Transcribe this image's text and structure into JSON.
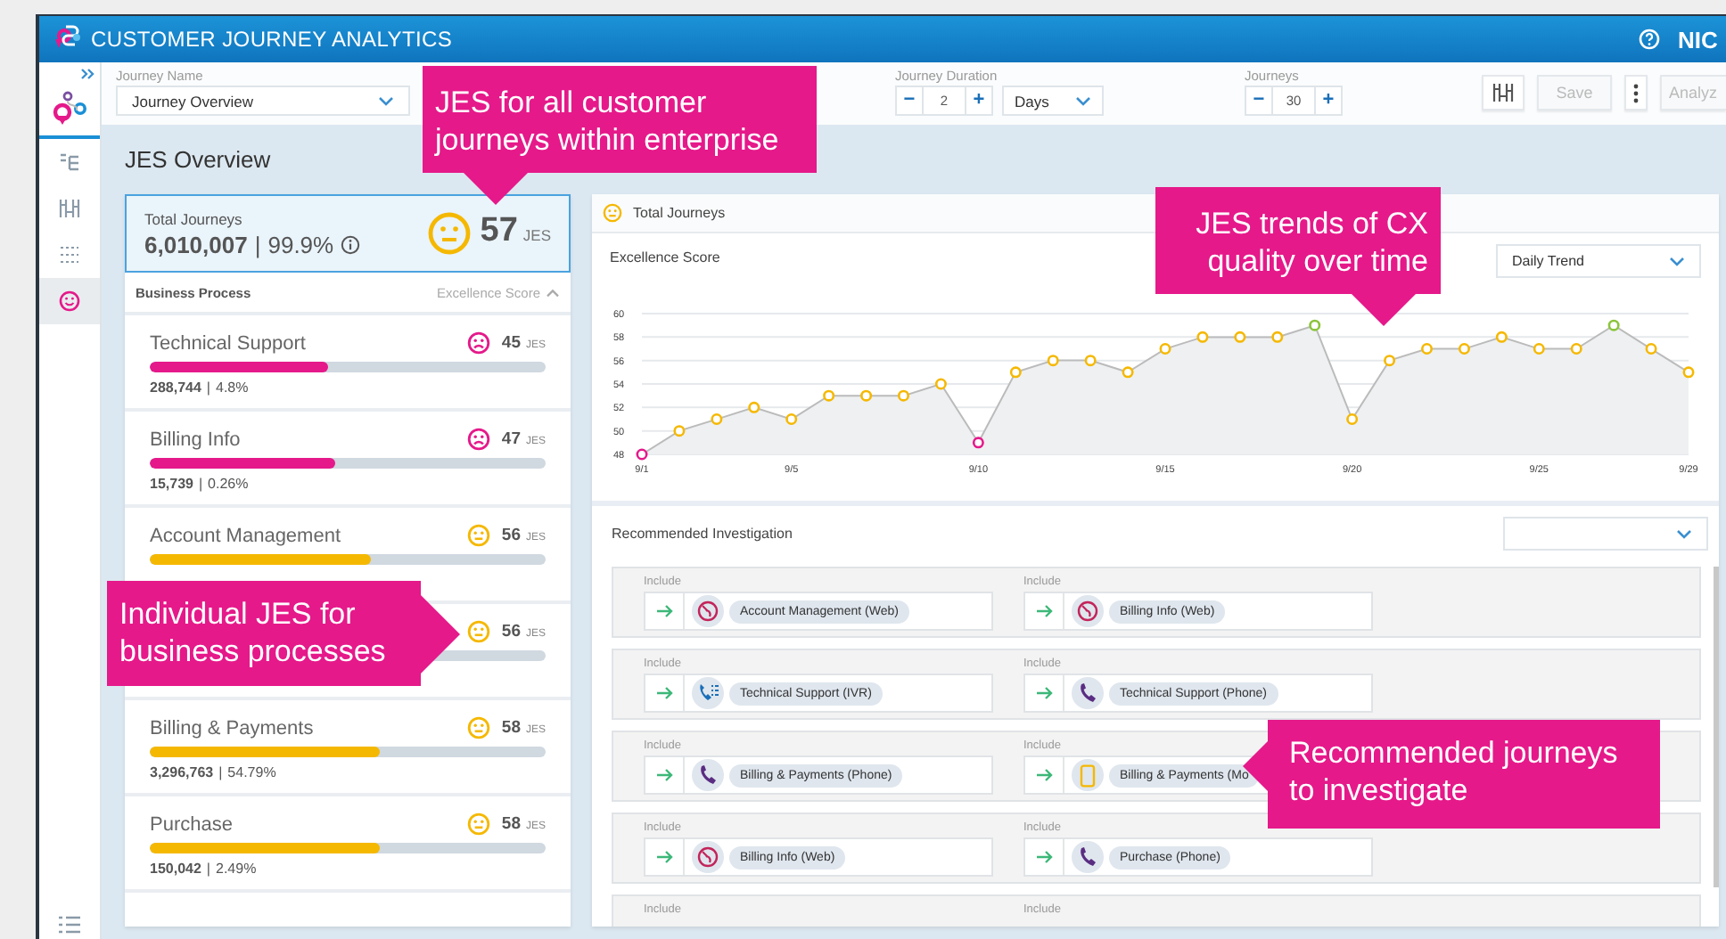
{
  "app": {
    "title": "CUSTOMER JOURNEY ANALYTICS",
    "brand": "NIC"
  },
  "sidebar": {
    "items": [
      {
        "kind": "flow",
        "selected": false
      },
      {
        "kind": "columns",
        "selected": false
      },
      {
        "kind": "grid",
        "selected": false
      },
      {
        "kind": "smiley",
        "selected": true
      }
    ]
  },
  "toolbar": {
    "journey_name": {
      "label": "Journey Name",
      "value": "Journey Overview"
    },
    "journey_duration": {
      "label": "Journey Duration",
      "minus": "−",
      "value": "2",
      "plus": "+",
      "unit": "Days"
    },
    "journeys": {
      "label": "Journeys",
      "minus": "−",
      "value": "30",
      "plus": "+"
    },
    "buttons": [
      {
        "kind": "icon"
      },
      {
        "kind": "text",
        "label": "Save",
        "disabled": true
      },
      {
        "kind": "kebab"
      },
      {
        "kind": "text",
        "label": "Analyz",
        "disabled": true
      }
    ]
  },
  "overview": {
    "title": "JES Overview",
    "total": {
      "label": "Total Journeys",
      "count": "6,010,007",
      "separator": "|",
      "percent": "99.9%",
      "score": "57",
      "unit": "JES"
    },
    "header": {
      "left": "Business Process",
      "right": "Excellence Score"
    },
    "processes": [
      {
        "name": "Technical Support",
        "kind": "sad",
        "color": "#e5198a",
        "score": "45",
        "unit": "JES",
        "level": 0.45,
        "count": "288,744",
        "separator": "|",
        "percent": "4.8%"
      },
      {
        "name": "Billing Info",
        "kind": "sad",
        "color": "#e5198a",
        "score": "47",
        "unit": "JES",
        "level": 0.47,
        "count": "15,739",
        "separator": "|",
        "percent": "0.26%"
      },
      {
        "name": "Account Management",
        "kind": "neutral",
        "color": "#f5b800",
        "score": "56",
        "unit": "JES",
        "level": 0.56
      },
      {
        "kind": "neutral",
        "color": "#f5b800",
        "score": "56",
        "unit": "JES"
      },
      {
        "name": "Billing & Payments",
        "kind": "neutral",
        "color": "#f5b800",
        "score": "58",
        "unit": "JES",
        "level": 0.58,
        "count": "3,296,763",
        "separator": "|",
        "percent": "54.79%"
      },
      {
        "name": "Purchase",
        "kind": "neutral",
        "color": "#f5b800",
        "score": "58",
        "unit": "JES",
        "level": 0.58,
        "count": "150,042",
        "separator": "|",
        "percent": "2.49%"
      }
    ]
  },
  "trend": {
    "title": "Total Journeys",
    "period": "Daily Trend",
    "chart_data": {
      "type": "line",
      "categories": [
        "9/1",
        null,
        null,
        null,
        "9/5",
        null,
        null,
        null,
        null,
        "9/10",
        null,
        null,
        null,
        null,
        "9/15",
        null,
        null,
        null,
        null,
        "9/20",
        null,
        null,
        null,
        null,
        "9/25",
        null,
        null,
        null,
        "9/29"
      ],
      "series": [
        {
          "name": "Excellence Score",
          "color": "#bbbbbb",
          "values": [
            48,
            50,
            51,
            52,
            51,
            53,
            53,
            53,
            54,
            49,
            55,
            56,
            56,
            55,
            57,
            58,
            58,
            58,
            59,
            51,
            56,
            57,
            57,
            58,
            57,
            57,
            59,
            57,
            55
          ]
        }
      ],
      "ylim": [
        48,
        60
      ],
      "yticks": [
        48,
        50,
        52,
        54,
        56,
        58,
        60
      ],
      "grid": true,
      "marker": true
    }
  },
  "recommended": {
    "title": "Recommended Investigation",
    "rows": [
      [
        {
          "caption": "Include",
          "kind": "web",
          "name": "Account Management (Web)"
        },
        {
          "caption": "Include",
          "kind": "web",
          "name": "Billing Info (Web)"
        }
      ],
      [
        {
          "caption": "Include",
          "kind": "ivr",
          "name": "Technical Support (IVR)"
        },
        {
          "caption": "Include",
          "kind": "phone",
          "name": "Technical Support (Phone)"
        }
      ],
      [
        {
          "caption": "Include",
          "kind": "phone",
          "name": "Billing & Payments (Phone)"
        },
        {
          "caption": "Include",
          "kind": "mobile",
          "name": "Billing & Payments (Mo"
        }
      ],
      [
        {
          "caption": "Include",
          "kind": "web",
          "name": "Billing Info (Web)"
        },
        {
          "caption": "Include",
          "kind": "phone",
          "name": "Purchase (Phone)"
        }
      ],
      [
        {
          "caption": "Include"
        },
        {
          "caption": "Include"
        }
      ]
    ]
  },
  "callouts": [
    {
      "text": "JES for all customer journeys within enterprise",
      "kind": "down"
    },
    {
      "text": "JES trends of CX quality over time",
      "kind": "down"
    },
    {
      "text": "Individual JES for business processes",
      "kind": "right"
    },
    {
      "text": "Recommended journeys to investigate",
      "kind": "left"
    }
  ]
}
